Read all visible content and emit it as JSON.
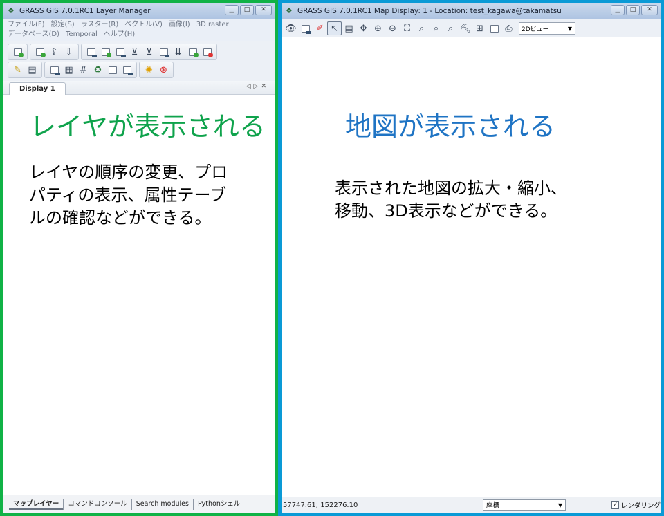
{
  "layer_manager": {
    "title": "GRASS GIS 7.0.1RC1 Layer Manager",
    "menu_row1": [
      "ファイル(F)",
      "設定(S)",
      "ラスター(R)",
      "ベクトル(V)",
      "画像(I)",
      "3D raster"
    ],
    "menu_row2": [
      "データベース(D)",
      "Temporal",
      "ヘルプ(H)"
    ],
    "display_tab": "Display 1",
    "heading": "レイヤが表示される",
    "description_lines": [
      "レイヤの順序の変更、プロ",
      "パティの表示、属性テーブ",
      "ルの確認などができる。"
    ],
    "bottom_tabs": [
      "マップレイヤー",
      "コマンドコンソール",
      "Search modules",
      "Pythonシェル"
    ],
    "accent_color": "#10b246"
  },
  "map_display": {
    "title": "GRASS GIS 7.0.1RC1 Map Display: 1  - Location: test_kagawa@takamatsu",
    "view_mode": "2Dビュー",
    "heading": "地図が表示される",
    "description_lines": [
      "表示された地図の拡大・縮小、",
      "移動、3D表示などができる。"
    ],
    "coordinates": "57747.61; 152276.10",
    "status_mode": "座標",
    "render_label": "レンダリング",
    "render_checked": true,
    "accent_color": "#0a9ad6"
  },
  "icons": {
    "layer_toolbar": [
      "new-display-icon",
      "workspace-new-icon",
      "workspace-open-icon",
      "workspace-save-icon",
      "add-raster-icon",
      "add-multiple-raster-icon",
      "add-vector-icon",
      "add-multiple-vector-icon",
      "add-overlay-icon",
      "add-group-icon",
      "import-icon",
      "remove-layer-icon",
      "edit-vector-icon",
      "attribute-table-icon",
      "georectify-icon",
      "map-calc-icon",
      "grid-icon",
      "modeler-icon",
      "gcp-icon",
      "nviz-icon",
      "settings-icon",
      "help-icon"
    ],
    "map_toolbar": [
      "display-icon",
      "render-icon",
      "erase-icon",
      "pointer-icon",
      "query-icon",
      "pan-icon",
      "zoom-in-icon",
      "zoom-out-icon",
      "zoom-extent-icon",
      "zoom-back-icon",
      "zoom-menu-icon",
      "zoom-region-icon",
      "analyze-icon",
      "decoration-icon",
      "save-image-icon",
      "print-icon"
    ]
  }
}
